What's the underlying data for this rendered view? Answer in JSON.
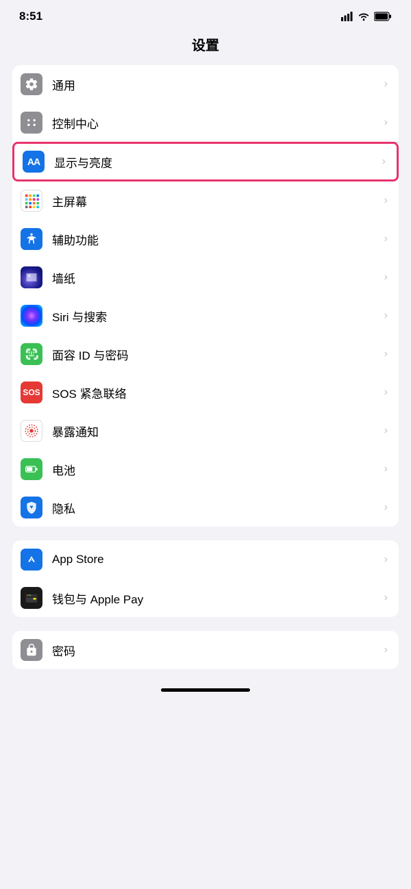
{
  "statusBar": {
    "time": "8:51",
    "signal": "signal",
    "wifi": "wifi",
    "battery": "battery"
  },
  "pageTitle": "设置",
  "group1": {
    "items": [
      {
        "id": "general",
        "label": "通用",
        "iconType": "gear",
        "iconBg": "gray",
        "highlighted": false
      },
      {
        "id": "control-center",
        "label": "控制中心",
        "iconType": "sliders",
        "iconBg": "gray",
        "highlighted": false
      },
      {
        "id": "display",
        "label": "显示与亮度",
        "iconType": "aa",
        "iconBg": "blue-aa",
        "highlighted": true
      },
      {
        "id": "home-screen",
        "label": "主屏幕",
        "iconType": "grid",
        "iconBg": "colorful",
        "highlighted": false
      },
      {
        "id": "accessibility",
        "label": "辅助功能",
        "iconType": "accessibility",
        "iconBg": "blue-access",
        "highlighted": false
      },
      {
        "id": "wallpaper",
        "label": "墙纸",
        "iconType": "wallpaper",
        "iconBg": "blue-wallpaper",
        "highlighted": false
      },
      {
        "id": "siri",
        "label": "Siri 与搜索",
        "iconType": "siri",
        "iconBg": "siri",
        "highlighted": false
      },
      {
        "id": "faceid",
        "label": "面容 ID 与密码",
        "iconType": "faceid",
        "iconBg": "face-id",
        "highlighted": false
      },
      {
        "id": "sos",
        "label": "SOS 紧急联络",
        "iconType": "sos",
        "iconBg": "sos",
        "highlighted": false
      },
      {
        "id": "exposure",
        "label": "暴露通知",
        "iconType": "exposure",
        "iconBg": "exposure",
        "highlighted": false
      },
      {
        "id": "battery",
        "label": "电池",
        "iconType": "battery",
        "iconBg": "battery",
        "highlighted": false
      },
      {
        "id": "privacy",
        "label": "隐私",
        "iconType": "privacy",
        "iconBg": "privacy",
        "highlighted": false
      }
    ]
  },
  "group2": {
    "items": [
      {
        "id": "appstore",
        "label": "App Store",
        "iconType": "appstore",
        "iconBg": "appstore",
        "highlighted": false
      },
      {
        "id": "wallet",
        "label": "钱包与 Apple Pay",
        "iconType": "wallet",
        "iconBg": "wallet",
        "highlighted": false
      }
    ]
  },
  "group3": {
    "items": [
      {
        "id": "password",
        "label": "密码",
        "iconType": "password",
        "iconBg": "password",
        "highlighted": false
      }
    ]
  }
}
